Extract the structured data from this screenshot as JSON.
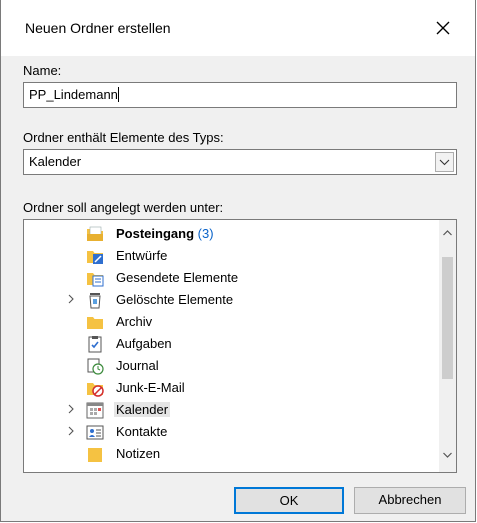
{
  "dialog": {
    "title": "Neuen Ordner erstellen",
    "name_label": "Name:",
    "name_value": "PP_Lindemann",
    "type_label": "Ordner enthält Elemente des Typs:",
    "type_value": "Kalender",
    "location_label": "Ordner soll angelegt werden unter:",
    "ok_label": "OK",
    "cancel_label": "Abbrechen"
  },
  "tree": {
    "items": [
      {
        "label": "Posteingang",
        "count": "(3)",
        "icon": "inbox-icon",
        "bold": true,
        "expandable": false
      },
      {
        "label": "Entwürfe",
        "icon": "drafts-icon",
        "expandable": false
      },
      {
        "label": "Gesendete Elemente",
        "icon": "sent-icon",
        "expandable": false
      },
      {
        "label": "Gelöschte Elemente",
        "icon": "trash-icon",
        "expandable": true
      },
      {
        "label": "Archiv",
        "icon": "archive-folder-icon",
        "expandable": false
      },
      {
        "label": "Aufgaben",
        "icon": "tasks-icon",
        "expandable": false
      },
      {
        "label": "Journal",
        "icon": "journal-icon",
        "expandable": false
      },
      {
        "label": "Junk-E-Mail",
        "icon": "junk-icon",
        "expandable": false
      },
      {
        "label": "Kalender",
        "icon": "calendar-icon",
        "expandable": true,
        "selected": true
      },
      {
        "label": "Kontakte",
        "icon": "contacts-icon",
        "expandable": true
      },
      {
        "label": "Notizen",
        "icon": "notes-icon",
        "expandable": false
      }
    ]
  },
  "colors": {
    "accent": "#0078d7",
    "folder": "#f5c242",
    "count": "#0a63c9"
  }
}
